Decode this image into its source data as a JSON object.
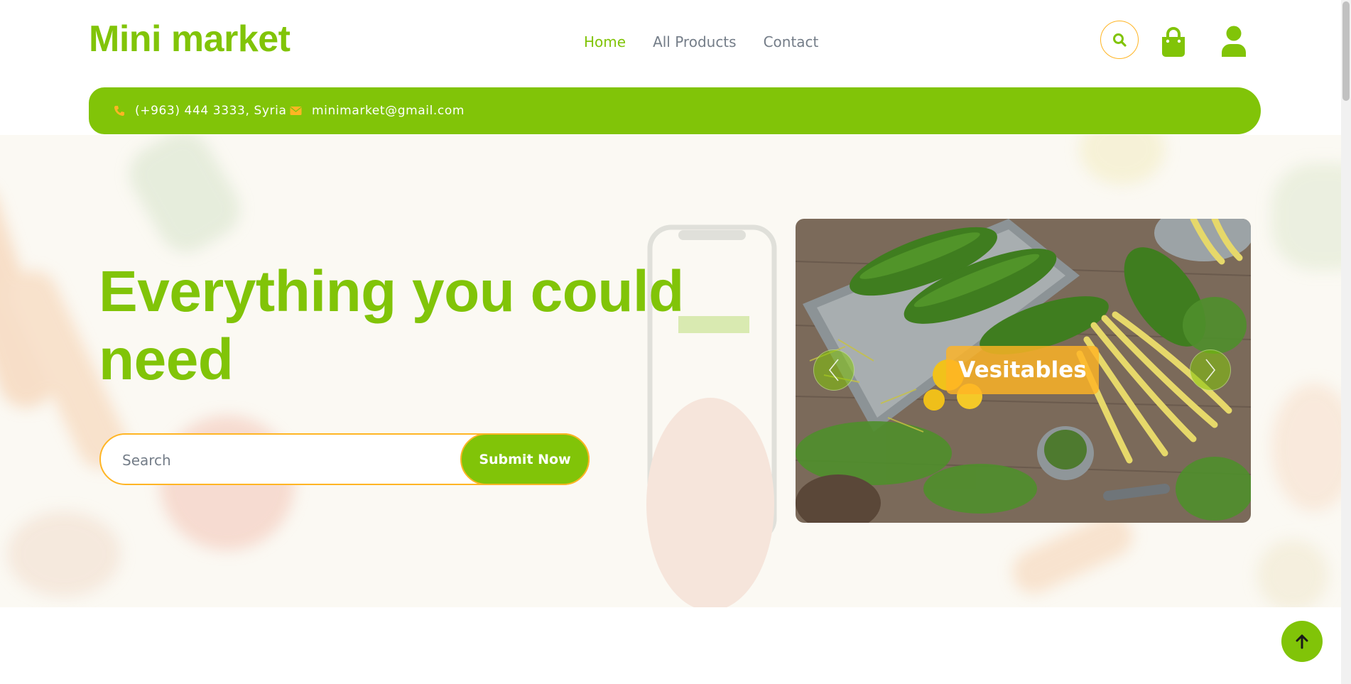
{
  "brand": {
    "name": "Mini market"
  },
  "nav": {
    "items": [
      {
        "label": "Home",
        "active": true
      },
      {
        "label": "All Products",
        "active": false
      },
      {
        "label": "Contact",
        "active": false
      }
    ]
  },
  "header_icons": {
    "search": "search-icon",
    "cart": "shopping-bag-icon",
    "account": "user-icon"
  },
  "topbar": {
    "phone": "(+963) 444 3333, Syria",
    "email": "minimarket@gmail.com"
  },
  "hero": {
    "title": "Everything you could need",
    "search_placeholder": "Search",
    "submit_label": "Submit Now"
  },
  "carousel": {
    "caption": "Vesitables",
    "prev_icon": "chevron-left-icon",
    "next_icon": "chevron-right-icon"
  },
  "back_to_top": {
    "icon": "arrow-up-icon"
  },
  "colors": {
    "primary": "#81c408",
    "secondary": "#ffb524",
    "text_muted": "#747d88",
    "hero_bg": "#fbf9f3"
  }
}
